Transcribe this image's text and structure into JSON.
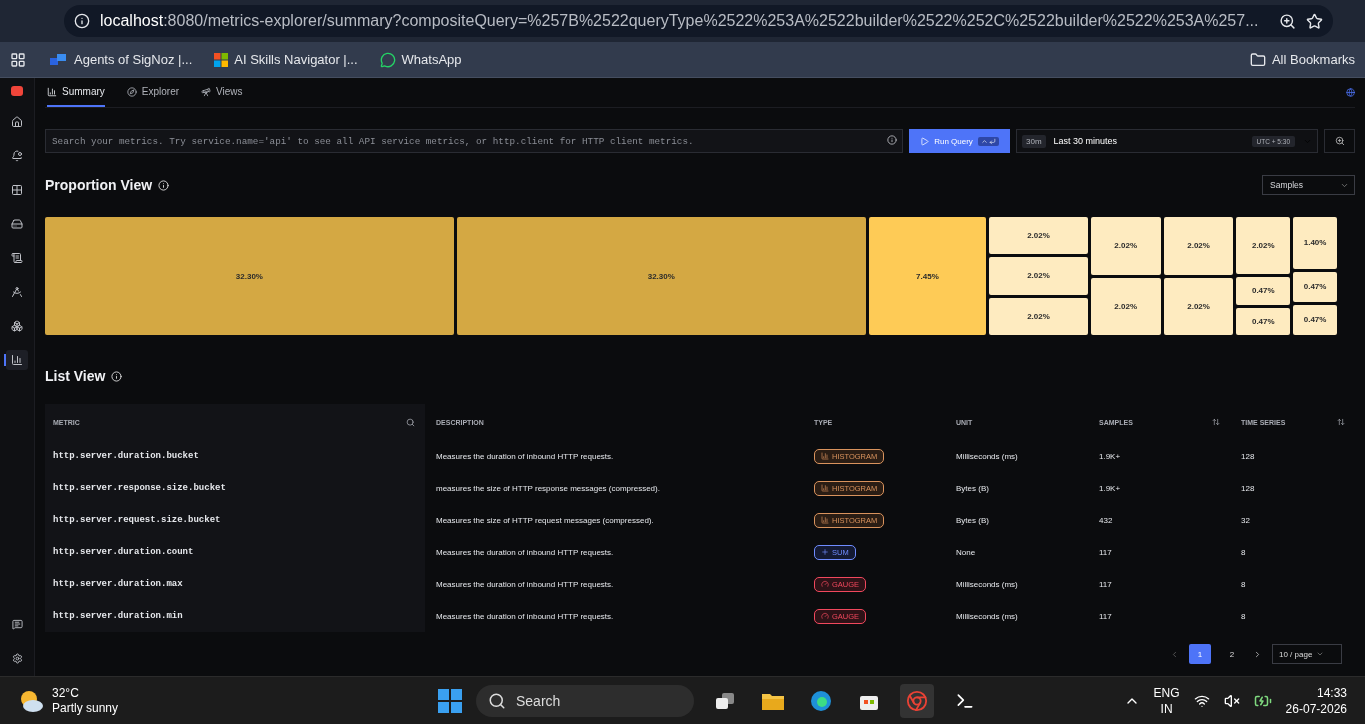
{
  "browser": {
    "url_host": "localhost",
    "url_rest": ":8080/metrics-explorer/summary?compositeQuery=%257B%2522queryType%2522%253A%2522builder%2522%252C%2522builder%2522%253A%257...",
    "bookmarks": [
      {
        "label": "Agents of SigNoz |...",
        "kind": "agents"
      },
      {
        "label": "AI Skills Navigator |...",
        "kind": "windows"
      },
      {
        "label": "WhatsApp",
        "kind": "chat"
      }
    ],
    "all_bookmarks": "All Bookmarks"
  },
  "sidebar": {
    "items": [
      {
        "kind": "home",
        "selected": false
      },
      {
        "kind": "alert",
        "selected": false
      },
      {
        "kind": "grid",
        "selected": false
      },
      {
        "kind": "storage",
        "selected": false
      },
      {
        "kind": "logs",
        "selected": false
      },
      {
        "kind": "compass",
        "selected": false
      },
      {
        "kind": "nodes",
        "selected": false
      },
      {
        "kind": "chart",
        "selected": true
      }
    ],
    "bottom": [
      {
        "kind": "message"
      },
      {
        "kind": "settings"
      }
    ]
  },
  "tabs": [
    {
      "label": "Summary",
      "kind": "chart",
      "selected": true
    },
    {
      "label": "Explorer",
      "kind": "compass",
      "selected": false
    },
    {
      "label": "Views",
      "kind": "views",
      "selected": false
    }
  ],
  "search": {
    "placeholder": "Search your metrics. Try service.name='api' to see all API service metrics, or http.client for HTTP client metrics."
  },
  "run_query": "Run Query",
  "time": {
    "badge": "30m",
    "label": "Last 30 minutes",
    "timezone": "UTC + 5:30"
  },
  "proportion": {
    "title": "Proportion View",
    "sort": "Samples",
    "columns": [
      [
        {
          "label": "32.30%",
          "color": "#d4a843"
        }
      ],
      [
        {
          "label": "32.30%",
          "color": "#d4a843"
        }
      ],
      [
        {
          "label": "7.45%",
          "color": "#fecb56"
        }
      ],
      [
        {
          "label": "2.02%",
          "color": "#feebc0"
        },
        {
          "label": "2.02%",
          "color": "#feebc0"
        },
        {
          "label": "2.02%",
          "color": "#feebc0"
        }
      ],
      [
        {
          "label": "2.02%",
          "color": "#feebc0"
        },
        {
          "label": "2.02%",
          "color": "#feebc0"
        }
      ],
      [
        {
          "label": "2.02%",
          "color": "#feebc0"
        },
        {
          "label": "2.02%",
          "color": "#feebc0"
        }
      ],
      [
        {
          "label": "2.02%",
          "color": "#feebc0"
        },
        {
          "label": "0.47%",
          "color": "#feebc0"
        },
        {
          "label": "0.47%",
          "color": "#feebc0"
        }
      ],
      [
        {
          "label": "1.40%",
          "color": "#feebc0"
        },
        {
          "label": "0.47%",
          "color": "#feebc0"
        },
        {
          "label": "0.47%",
          "color": "#feebc0"
        }
      ]
    ]
  },
  "list": {
    "title": "List View",
    "columns": [
      "METRIC",
      "DESCRIPTION",
      "TYPE",
      "UNIT",
      "SAMPLES",
      "TIME SERIES"
    ],
    "rows": [
      {
        "metric": "http.server.duration.bucket",
        "description": "Measures the duration of inbound HTTP requests.",
        "type": "HISTOGRAM",
        "kind": "histogram",
        "unit": "Milliseconds (ms)",
        "samples": "1.9K+",
        "time_series": "128"
      },
      {
        "metric": "http.server.response.size.bucket",
        "description": "measures the size of HTTP response messages (compressed).",
        "type": "HISTOGRAM",
        "kind": "histogram",
        "unit": "Bytes (B)",
        "samples": "1.9K+",
        "time_series": "128"
      },
      {
        "metric": "http.server.request.size.bucket",
        "description": "Measures the size of HTTP request messages (compressed).",
        "type": "HISTOGRAM",
        "kind": "histogram",
        "unit": "Bytes (B)",
        "samples": "432",
        "time_series": "32"
      },
      {
        "metric": "http.server.duration.count",
        "description": "Measures the duration of inbound HTTP requests.",
        "type": "SUM",
        "kind": "sum",
        "unit": "None",
        "samples": "117",
        "time_series": "8"
      },
      {
        "metric": "http.server.duration.max",
        "description": "Measures the duration of inbound HTTP requests.",
        "type": "GAUGE",
        "kind": "gauge",
        "unit": "Milliseconds (ms)",
        "samples": "117",
        "time_series": "8"
      },
      {
        "metric": "http.server.duration.min",
        "description": "Measures the duration of inbound HTTP requests.",
        "type": "GAUGE",
        "kind": "gauge",
        "unit": "Milliseconds (ms)",
        "samples": "117",
        "time_series": "8"
      }
    ],
    "pages": [
      {
        "label": "1",
        "selected": true
      },
      {
        "label": "2",
        "selected": false
      }
    ],
    "page_size": "10 / page"
  },
  "taskbar": {
    "temperature": "32°C",
    "weather": "Partly sunny",
    "search": "Search",
    "lang": "ENG",
    "region": "IN",
    "time": "14:33",
    "date": "26-07-2026"
  }
}
